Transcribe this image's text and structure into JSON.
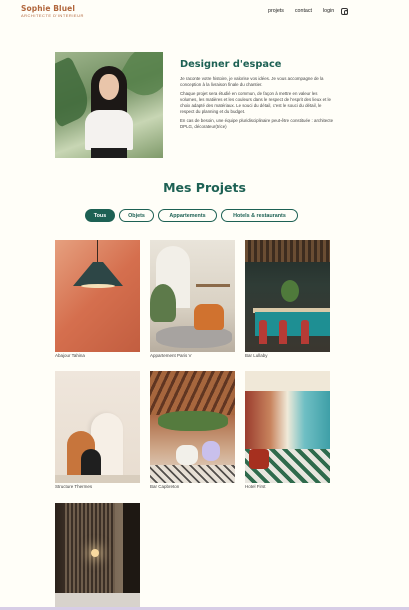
{
  "header": {
    "logo_name": "Sophie Bluel",
    "logo_sub": "ARCHITECTE D'INTERIEUR",
    "nav": [
      "projets",
      "contact",
      "login"
    ],
    "instagram_icon": "instagram-icon"
  },
  "intro": {
    "title": "Designer d'espace",
    "paragraphs": [
      "Je raconte votre histoire, je valorise vos idées. Je vous accompagne de la conception à la livraison finale du chantier.",
      "Chaque projet sera étudié en commun, de façon à mettre en valeur les volumes, les matières et les couleurs dans le respect de l'esprit des lieux et le choix adapté des matériaux. Le souci du détail, c'est le souci du détail, le respect du planning et du budget.",
      "En cas de besoin, une équipe pluridisciplinaire peut-être constituée : architecte DPLG, décorateur(trice)"
    ]
  },
  "projects_section": {
    "title": "Mes Projets",
    "filters": [
      "Tous",
      "Objets",
      "Appartements",
      "Hotels & restaurants"
    ],
    "active_filter": "Tous"
  },
  "works": [
    {
      "caption": "Abajour Tahina"
    },
    {
      "caption": "Appartement Paris V"
    },
    {
      "caption": "Bar Lullaby"
    },
    {
      "caption": "Structure Thermes"
    },
    {
      "caption": "Bar Capbreton"
    },
    {
      "caption": "Hotel First"
    },
    {
      "caption": ""
    }
  ],
  "colors": {
    "accent": "#1d6154",
    "logo": "#b1663c",
    "background": "#fffef8"
  }
}
